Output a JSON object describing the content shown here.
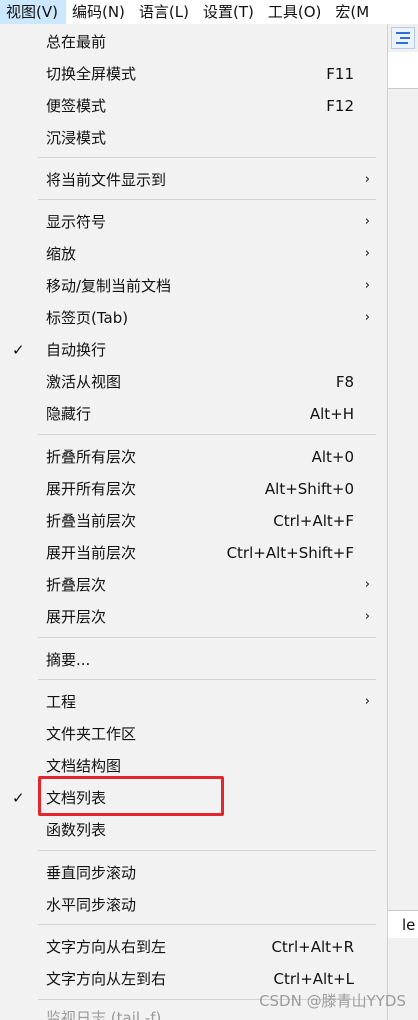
{
  "menubar": {
    "items": [
      "视图(V)",
      "编码(N)",
      "语言(L)",
      "设置(T)",
      "工具(O)",
      "宏(M"
    ]
  },
  "editor": {
    "lower_text": "le"
  },
  "dropdown": {
    "items": [
      {
        "label": "总在最前",
        "shortcut": "",
        "submenu": false,
        "checked": false
      },
      {
        "label": "切换全屏模式",
        "shortcut": "F11",
        "submenu": false,
        "checked": false
      },
      {
        "label": "便签模式",
        "shortcut": "F12",
        "submenu": false,
        "checked": false
      },
      {
        "label": "沉浸模式",
        "shortcut": "",
        "submenu": false,
        "checked": false
      },
      {
        "label": "将当前文件显示到",
        "shortcut": "",
        "submenu": true,
        "checked": false
      },
      {
        "label": "显示符号",
        "shortcut": "",
        "submenu": true,
        "checked": false
      },
      {
        "label": "缩放",
        "shortcut": "",
        "submenu": true,
        "checked": false
      },
      {
        "label": "移动/复制当前文档",
        "shortcut": "",
        "submenu": true,
        "checked": false
      },
      {
        "label": "标签页(Tab)",
        "shortcut": "",
        "submenu": true,
        "checked": false
      },
      {
        "label": "自动换行",
        "shortcut": "",
        "submenu": false,
        "checked": true
      },
      {
        "label": "激活从视图",
        "shortcut": "F8",
        "submenu": false,
        "checked": false
      },
      {
        "label": "隐藏行",
        "shortcut": "Alt+H",
        "submenu": false,
        "checked": false
      },
      {
        "label": "折叠所有层次",
        "shortcut": "Alt+0",
        "submenu": false,
        "checked": false
      },
      {
        "label": "展开所有层次",
        "shortcut": "Alt+Shift+0",
        "submenu": false,
        "checked": false
      },
      {
        "label": "折叠当前层次",
        "shortcut": "Ctrl+Alt+F",
        "submenu": false,
        "checked": false
      },
      {
        "label": "展开当前层次",
        "shortcut": "Ctrl+Alt+Shift+F",
        "submenu": false,
        "checked": false
      },
      {
        "label": "折叠层次",
        "shortcut": "",
        "submenu": true,
        "checked": false
      },
      {
        "label": "展开层次",
        "shortcut": "",
        "submenu": true,
        "checked": false
      },
      {
        "label": "摘要...",
        "shortcut": "",
        "submenu": false,
        "checked": false
      },
      {
        "label": "工程",
        "shortcut": "",
        "submenu": true,
        "checked": false
      },
      {
        "label": "文件夹工作区",
        "shortcut": "",
        "submenu": false,
        "checked": false
      },
      {
        "label": "文档结构图",
        "shortcut": "",
        "submenu": false,
        "checked": false
      },
      {
        "label": "文档列表",
        "shortcut": "",
        "submenu": false,
        "checked": true
      },
      {
        "label": "函数列表",
        "shortcut": "",
        "submenu": false,
        "checked": false
      },
      {
        "label": "垂直同步滚动",
        "shortcut": "",
        "submenu": false,
        "checked": false
      },
      {
        "label": "水平同步滚动",
        "shortcut": "",
        "submenu": false,
        "checked": false
      },
      {
        "label": "文字方向从右到左",
        "shortcut": "Ctrl+Alt+R",
        "submenu": false,
        "checked": false
      },
      {
        "label": "文字方向从左到右",
        "shortcut": "Ctrl+Alt+L",
        "submenu": false,
        "checked": false
      },
      {
        "label": "监视日志 (tail -f)",
        "shortcut": "",
        "submenu": false,
        "checked": false
      }
    ],
    "check_glyph": "✓",
    "arrow_glyph": "›"
  },
  "watermark": "CSDN @滕青山YYDS",
  "colors": {
    "menu_bg": "#f2f2f2",
    "active_menubar": "#cce8ff",
    "highlight_box": "#e2262e"
  }
}
